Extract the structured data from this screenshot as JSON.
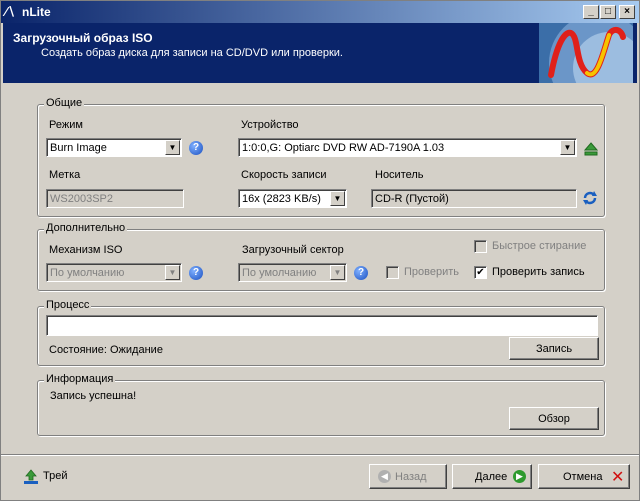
{
  "window": {
    "title": "nLite"
  },
  "header": {
    "title": "Загрузочный образ ISO",
    "subtitle": "Создать образ диска для записи на CD/DVD или проверки."
  },
  "general": {
    "legend": "Общие",
    "mode_label": "Режим",
    "mode_value": "Burn Image",
    "device_label": "Устройство",
    "device_value": "1:0:0,G: Optiarc  DVD RW AD-7190A  1.03",
    "label_label": "Метка",
    "label_value": "WS2003SP2",
    "speed_label": "Скорость записи",
    "speed_value": "16x (2823 KB/s)",
    "media_label": "Носитель",
    "media_value": "CD-R (Пустой)"
  },
  "advanced": {
    "legend": "Дополнительно",
    "iso_engine_label": "Механизм ISO",
    "iso_engine_value": "По умолчанию",
    "boot_sector_label": "Загрузочный сектор",
    "boot_sector_value": "По умолчанию",
    "quick_erase_label": "Быстрое стирание",
    "verify_label": "Проверить",
    "verify_write_label": "Проверить запись"
  },
  "process": {
    "legend": "Процесс",
    "status": "Состояние: Ожидание",
    "write_button": "Запись"
  },
  "info": {
    "legend": "Информация",
    "message": "Запись успешна!",
    "browse_button": "Обзор"
  },
  "footer": {
    "tray_label": "Трей",
    "back_label": "Назад",
    "next_label": "Далее",
    "cancel_label": "Отмена"
  }
}
